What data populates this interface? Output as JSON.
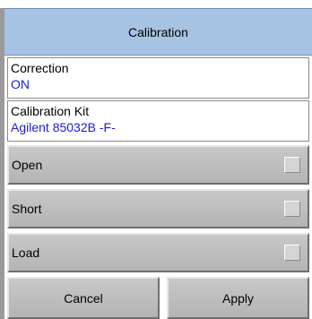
{
  "title": "Calibration",
  "correction": {
    "label": "Correction",
    "value": "ON"
  },
  "calibration_kit": {
    "label": "Calibration Kit",
    "value": "Agilent 85032B -F-"
  },
  "standards": [
    {
      "label": "Open",
      "indicator": "unchecked"
    },
    {
      "label": "Short",
      "indicator": "unchecked"
    },
    {
      "label": "Load",
      "indicator": "unchecked"
    }
  ],
  "actions": {
    "cancel_label": "Cancel",
    "apply_label": "Apply"
  },
  "colors": {
    "title_bar": "#a6c3e3",
    "value_text": "#1a1ad8",
    "button_face": "#c0c0c0"
  }
}
